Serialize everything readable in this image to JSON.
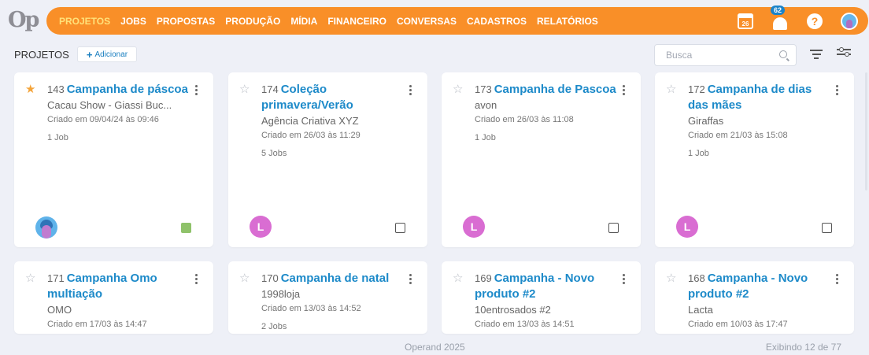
{
  "header": {
    "logo": "Op",
    "nav": [
      "PROJETOS",
      "JOBS",
      "PROPOSTAS",
      "PRODUÇÃO",
      "MÍDIA",
      "FINANCEIRO",
      "CONVERSAS",
      "CADASTROS",
      "RELATÓRIOS"
    ],
    "calendar_day": "26",
    "notifications_count": "62",
    "help_glyph": "?"
  },
  "toolbar": {
    "page_title": "PROJETOS",
    "add_label": "Adicionar",
    "search_placeholder": "Busca"
  },
  "cards": [
    {
      "num": "143",
      "title": "Campanha de páscoa",
      "client": "Cacau Show - Giassi Buc...",
      "created": "Criado em 09/04/24 às 09:46",
      "jobs": "1 Job",
      "starred": true,
      "avatar": "image",
      "status": "green"
    },
    {
      "num": "174",
      "title": "Coleção primavera/Verão",
      "client": "Agência Criativa XYZ",
      "created": "Criado em 26/03 às 11:29",
      "jobs": "5 Jobs",
      "starred": false,
      "avatar": "L",
      "status": "checkbox"
    },
    {
      "num": "173",
      "title": "Campanha de Pascoa",
      "client": "avon",
      "created": "Criado em 26/03 às 11:08",
      "jobs": "1 Job",
      "starred": false,
      "avatar": "L",
      "status": "checkbox"
    },
    {
      "num": "172",
      "title": "Campanha de dias das mães",
      "client": "Giraffas",
      "created": "Criado em 21/03 às 15:08",
      "jobs": "1 Job",
      "starred": false,
      "avatar": "L",
      "status": "checkbox"
    },
    {
      "num": "171",
      "title": "Campanha Omo multiação",
      "client": "OMO",
      "created": "Criado em 17/03 às 14:47",
      "jobs": "",
      "starred": false
    },
    {
      "num": "170",
      "title": "Campanha de natal",
      "client": "1998loja",
      "created": "Criado em 13/03 às 14:52",
      "jobs": "2 Jobs",
      "starred": false
    },
    {
      "num": "169",
      "title": "Campanha - Novo produto #2",
      "client": "10entrosados #2",
      "created": "Criado em 13/03 às 14:51",
      "jobs": "",
      "starred": false
    },
    {
      "num": "168",
      "title": "Campanha - Novo produto #2",
      "client": "Lacta",
      "created": "Criado em 10/03 às 17:47",
      "jobs": "",
      "starred": false
    }
  ],
  "footer": {
    "copyright": "Operand 2025",
    "showing": "Exibindo 12 de 77"
  }
}
